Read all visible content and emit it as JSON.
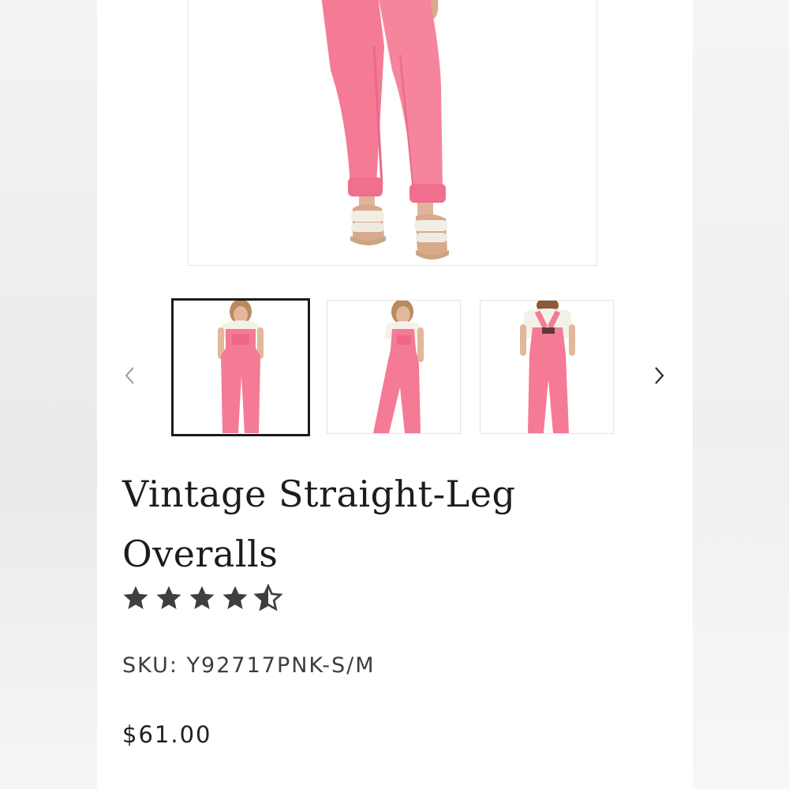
{
  "product": {
    "title": "Vintage Straight-Leg Overalls",
    "rating": 4.5,
    "rating_max": 5,
    "sku_label": "SKU: Y92717PNK-S/M",
    "price": "$61.00"
  },
  "gallery": {
    "selected_index": 0,
    "thumbnails": [
      {
        "name": "front view"
      },
      {
        "name": "side view"
      },
      {
        "name": "back view"
      }
    ],
    "prev_icon": "chevron-left-icon",
    "next_icon": "chevron-right-icon"
  },
  "colors": {
    "overalls": "#f47a95",
    "shirt": "#f4f1e8",
    "text": "#1c1c1c",
    "star": "#3f3f3f"
  }
}
